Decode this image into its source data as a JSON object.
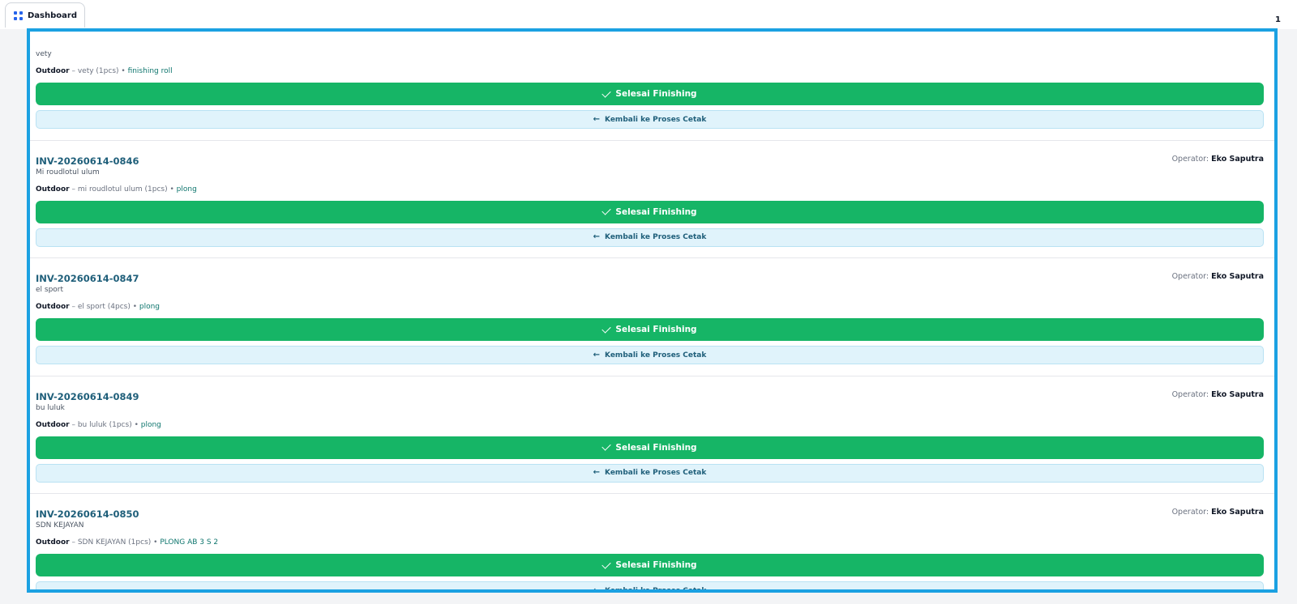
{
  "tab": {
    "label": "Dashboard"
  },
  "page_number": "1",
  "buttons": {
    "done_label": "Selesai Finishing",
    "back_label": "Kembali ke Proses Cetak"
  },
  "operator_label": "Operator:",
  "orders": [
    {
      "invoice": "",
      "operator": "",
      "customer": "vety",
      "category": "Outdoor",
      "item": "vety (1pcs)",
      "finishing": "finishing roll"
    },
    {
      "invoice": "INV-20260614-0846",
      "operator": "Eko Saputra",
      "customer": "Mi roudlotul ulum",
      "category": "Outdoor",
      "item": "mi roudlotul ulum (1pcs)",
      "finishing": "plong"
    },
    {
      "invoice": "INV-20260614-0847",
      "operator": "Eko Saputra",
      "customer": "el sport",
      "category": "Outdoor",
      "item": "el sport (4pcs)",
      "finishing": "plong"
    },
    {
      "invoice": "INV-20260614-0849",
      "operator": "Eko Saputra",
      "customer": "bu luluk",
      "category": "Outdoor",
      "item": "bu luluk (1pcs)",
      "finishing": "plong"
    },
    {
      "invoice": "INV-20260614-0850",
      "operator": "Eko Saputra",
      "customer": "SDN KEJAYAN",
      "category": "Outdoor",
      "item": "SDN KEJAYAN (1pcs)",
      "finishing": "PLONG AB 3 S 2"
    }
  ],
  "colors": {
    "accent": "#1ba1e2",
    "done": "#16b566",
    "back_bg": "#e0f3fb"
  }
}
